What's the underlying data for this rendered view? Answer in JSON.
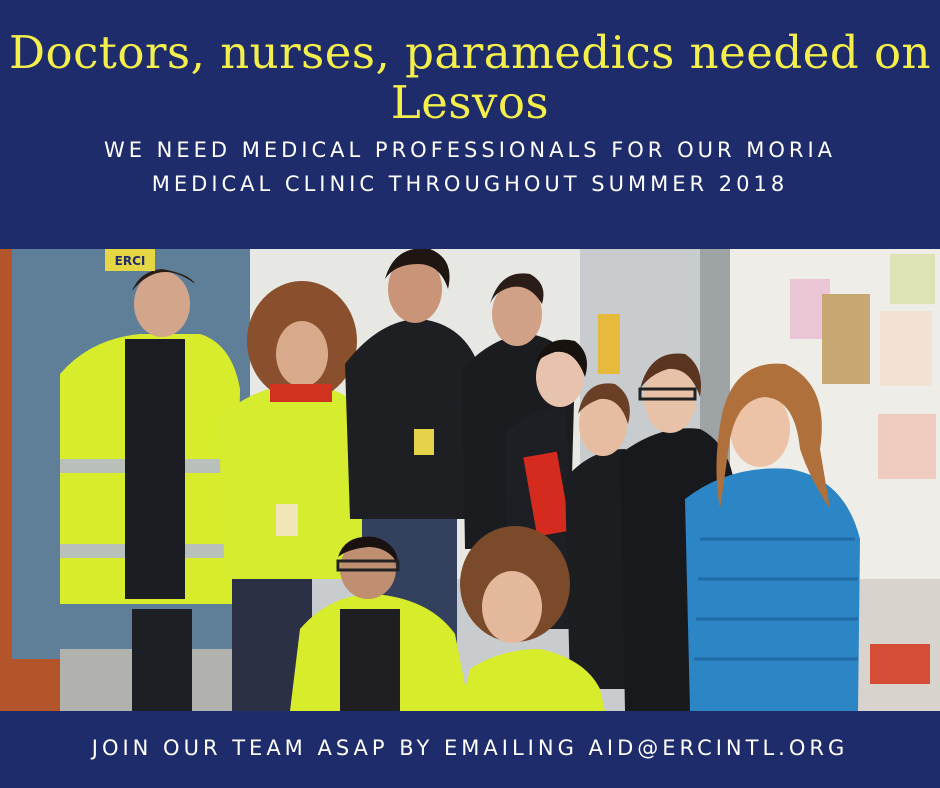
{
  "headline": "Doctors, nurses, paramedics needed on Lesvos",
  "subtitle_line1": "We need medical professionals for our Moria",
  "subtitle_line2": "medical clinic throughout Summer 2018",
  "photo": {
    "description_icon": "group-photo",
    "badge_text": "ERCI"
  },
  "cta": "Join our team ASAP by emailing aid@ercintl.org",
  "colors": {
    "background": "#1f2c6b",
    "headline": "#f4ef4a",
    "text": "#ffffff",
    "hi_vis": "#d7ec2b"
  }
}
